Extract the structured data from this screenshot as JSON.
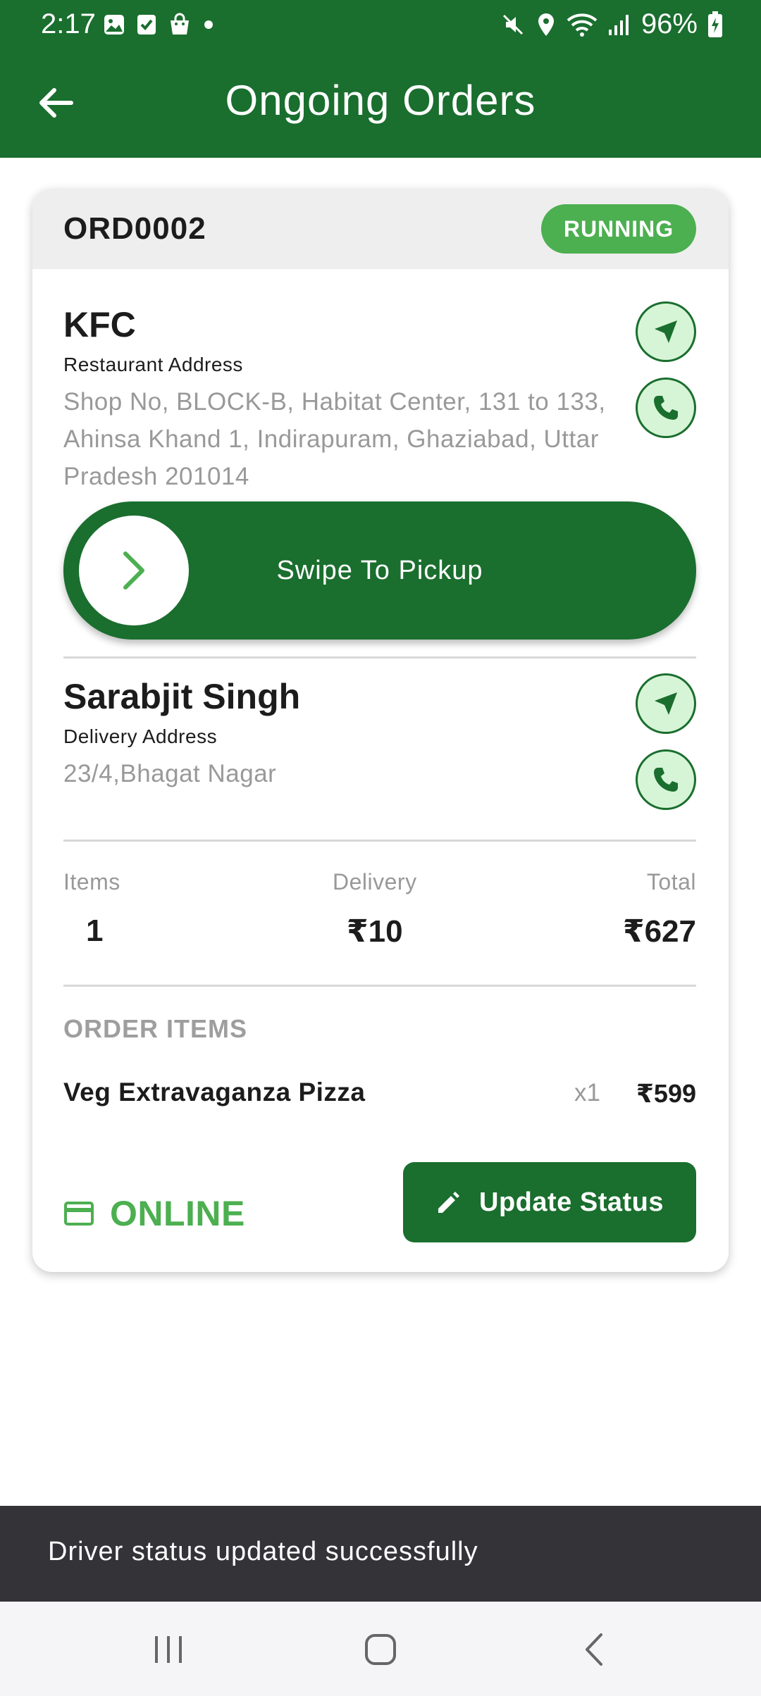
{
  "status_bar": {
    "time": "2:17",
    "battery": "96%",
    "left_icons": [
      "gallery-icon",
      "checkbox-icon",
      "shopping-bag-icon",
      "dot-icon"
    ],
    "right_icons": [
      "mute-icon",
      "location-icon",
      "wifi-icon",
      "signal-icon",
      "battery-charging-icon"
    ]
  },
  "app_bar": {
    "title": "Ongoing Orders",
    "back_icon": "arrow-left-icon"
  },
  "order": {
    "id": "ORD0002",
    "status": "RUNNING",
    "restaurant": {
      "name": "KFC",
      "address_label": "Restaurant Address",
      "address": "Shop No, BLOCK-B, Habitat Center, 131 to 133, Ahinsa Khand 1, Indirapuram, Ghaziabad, Uttar Pradesh 201014"
    },
    "swipe": {
      "label": "Swipe To Pickup",
      "icon": "chevron-right-icon"
    },
    "customer": {
      "name": "Sarabjit Singh",
      "address_label": "Delivery Address",
      "address": "23/4,Bhagat Nagar"
    },
    "stats": {
      "items_label": "Items",
      "items_value": "1",
      "delivery_label": "Delivery",
      "delivery_value": "₹10",
      "total_label": "Total",
      "total_value": "₹627"
    },
    "items_title": "ORDER ITEMS",
    "items": [
      {
        "name": "Veg Extravaganza Pizza",
        "qty": "x1",
        "price": "₹599"
      }
    ],
    "payment": {
      "method": "ONLINE",
      "icon": "credit-card-icon"
    },
    "update_button": {
      "label": "Update Status",
      "icon": "pencil-icon"
    }
  },
  "snackbar": {
    "message": "Driver status updated successfully"
  },
  "nav_bar": {
    "icons": [
      "recent-apps-icon",
      "home-icon",
      "back-icon"
    ]
  },
  "colors": {
    "primary": "#1a6e2e",
    "accent": "#4caf50",
    "badge_bg": "#d6f5d6",
    "snackbar": "#333338"
  }
}
